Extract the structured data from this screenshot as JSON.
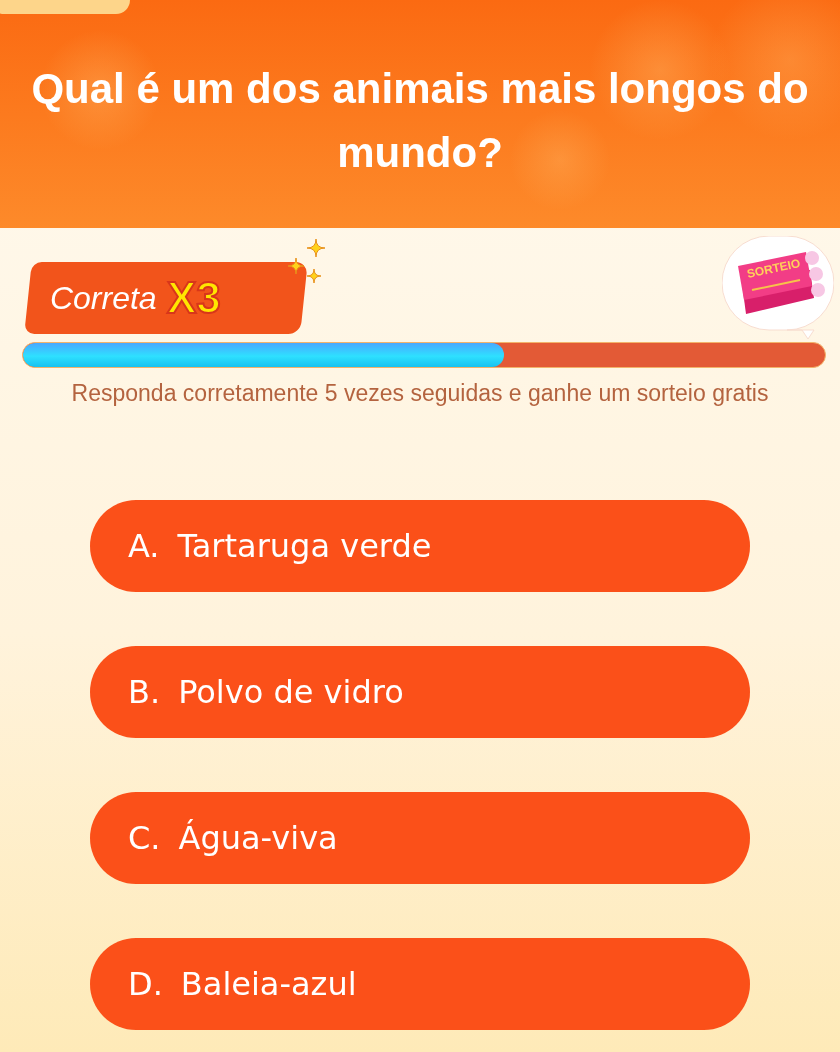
{
  "question": "Qual é um dos animais mais longos do mundo?",
  "streak": {
    "label": "Correta",
    "multiplier": "X3"
  },
  "reward": {
    "ticket_label": "SORTEIO"
  },
  "progress": {
    "level": 0.6
  },
  "hint": "Responda corretamente 5 vezes seguidas e ganhe um sorteio gratis",
  "options": [
    {
      "letter": "A.",
      "text": "Tartaruga verde"
    },
    {
      "letter": "B.",
      "text": "Polvo de vidro"
    },
    {
      "letter": "C.",
      "text": "Água-viva"
    },
    {
      "letter": "D.",
      "text": "Baleia-azul"
    }
  ]
}
